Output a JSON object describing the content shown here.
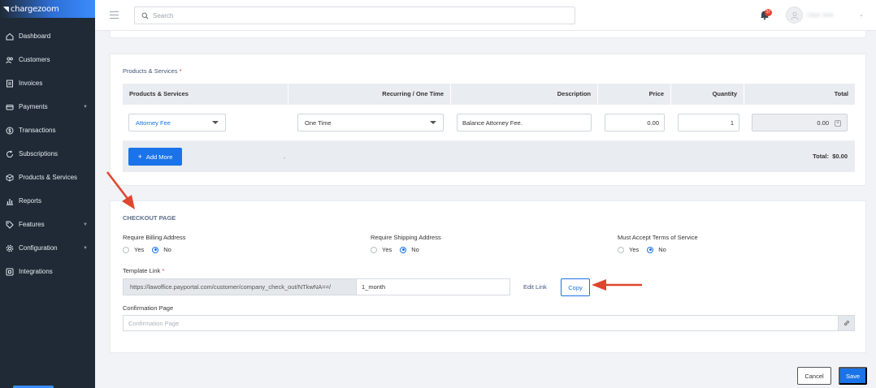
{
  "brand": {
    "name": "chargezoom"
  },
  "sidebar": {
    "items": [
      {
        "label": "Dashboard",
        "icon": "home-icon",
        "has_children": false
      },
      {
        "label": "Customers",
        "icon": "users-icon",
        "has_children": false
      },
      {
        "label": "Invoices",
        "icon": "invoice-icon",
        "has_children": false
      },
      {
        "label": "Payments",
        "icon": "payment-icon",
        "has_children": true
      },
      {
        "label": "Transactions",
        "icon": "dollar-icon",
        "has_children": false
      },
      {
        "label": "Subscriptions",
        "icon": "refresh-icon",
        "has_children": false
      },
      {
        "label": "Products & Services",
        "icon": "box-icon",
        "has_children": false
      },
      {
        "label": "Reports",
        "icon": "bar-chart-icon",
        "has_children": false
      },
      {
        "label": "Features",
        "icon": "tag-icon",
        "has_children": true
      },
      {
        "label": "Configuration",
        "icon": "gear-icon",
        "has_children": true
      },
      {
        "label": "Integrations",
        "icon": "integration-icon",
        "has_children": false
      }
    ]
  },
  "topbar": {
    "search_placeholder": "Search",
    "notification_count": "37",
    "username": "User one"
  },
  "products": {
    "title": "Products & Services",
    "columns": [
      "Products & Services",
      "Recurring / One Time",
      "Description",
      "Price",
      "Quantity",
      "Total"
    ],
    "row": {
      "product": "Attorney Fee",
      "recurring": "One Time",
      "description": "Balance Attorney Fee.",
      "price": "0.00",
      "quantity": "1",
      "total": "0.00"
    },
    "add_more_label": "Add More",
    "footer_dash": "-",
    "total_label": "Total:",
    "total_value": "$0.00"
  },
  "checkout": {
    "title": "CHECKOUT PAGE",
    "billing": {
      "label": "Require Billing Address",
      "yes": "Yes",
      "no": "No",
      "selected": "No"
    },
    "shipping": {
      "label": "Require Shipping Address",
      "yes": "Yes",
      "no": "No",
      "selected": "No"
    },
    "terms": {
      "label": "Must Accept Terms of Service",
      "yes": "Yes",
      "no": "No",
      "selected": "No"
    },
    "template_link_label": "Template Link",
    "template_link_prefix": "https://lawoffice.payportal.com/customer/company_check_out/NTkwNA==/",
    "template_link_value": "1_month",
    "edit_link_label": "Edit Link",
    "copy_label": "Copy",
    "confirmation_label": "Confirmation Page",
    "confirmation_placeholder": "Confirmation Page"
  },
  "actions": {
    "cancel_label": "Cancel",
    "save_label": "Save"
  },
  "colors": {
    "primary": "#1a73e8",
    "sidebar": "#1f2a36",
    "annotation": "#e0452f",
    "required": "#e0452f"
  }
}
